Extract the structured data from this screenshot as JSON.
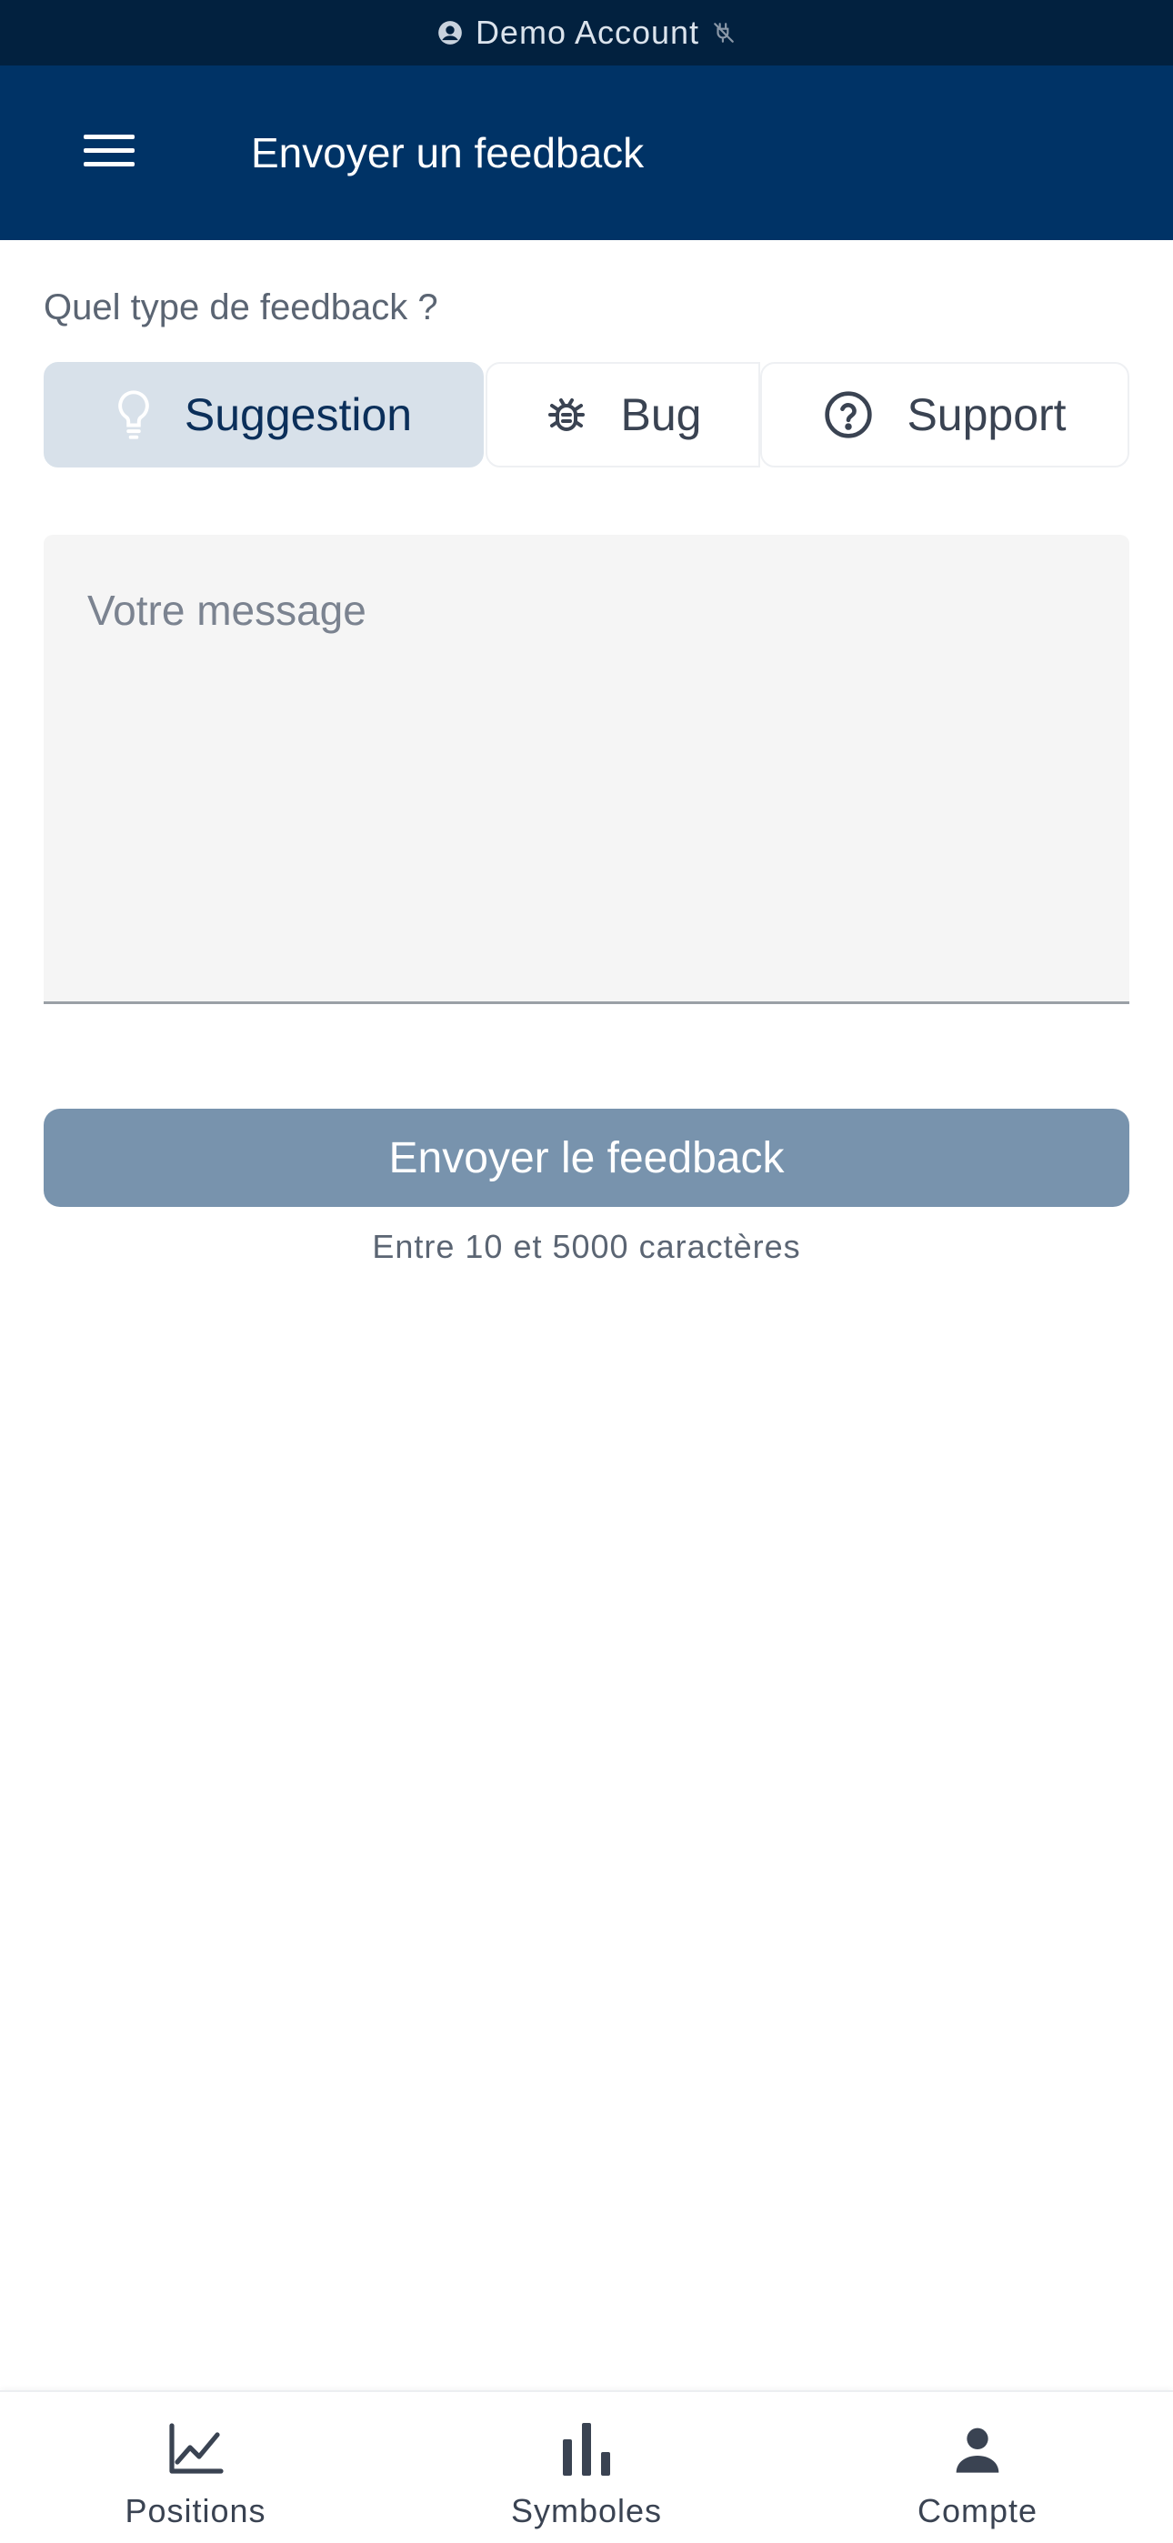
{
  "status_bar": {
    "account_label": "Demo Account",
    "account_icon": "account-circle-icon",
    "connection_icon": "offline-icon"
  },
  "app_bar": {
    "title": "Envoyer un feedback",
    "menu_icon": "hamburger-menu-icon"
  },
  "form": {
    "question": "Quel type de feedback ?",
    "types": [
      {
        "label": "Suggestion",
        "icon": "lightbulb-icon",
        "selected": true
      },
      {
        "label": "Bug",
        "icon": "bug-icon",
        "selected": false
      },
      {
        "label": "Support",
        "icon": "help-circle-icon",
        "selected": false
      }
    ],
    "message_placeholder": "Votre message",
    "message_value": "",
    "submit_label": "Envoyer le feedback",
    "hint": "Entre 10 et 5000 caractères"
  },
  "bottom_nav": {
    "items": [
      {
        "label": "Positions",
        "icon": "chart-line-icon"
      },
      {
        "label": "Symboles",
        "icon": "bar-chart-icon"
      },
      {
        "label": "Compte",
        "icon": "person-icon"
      }
    ]
  },
  "colors": {
    "status_bar_bg": "#02213f",
    "app_bar_bg": "#003366",
    "selected_segment_bg": "#d8e1ea",
    "submit_disabled_bg": "#7893ad"
  }
}
